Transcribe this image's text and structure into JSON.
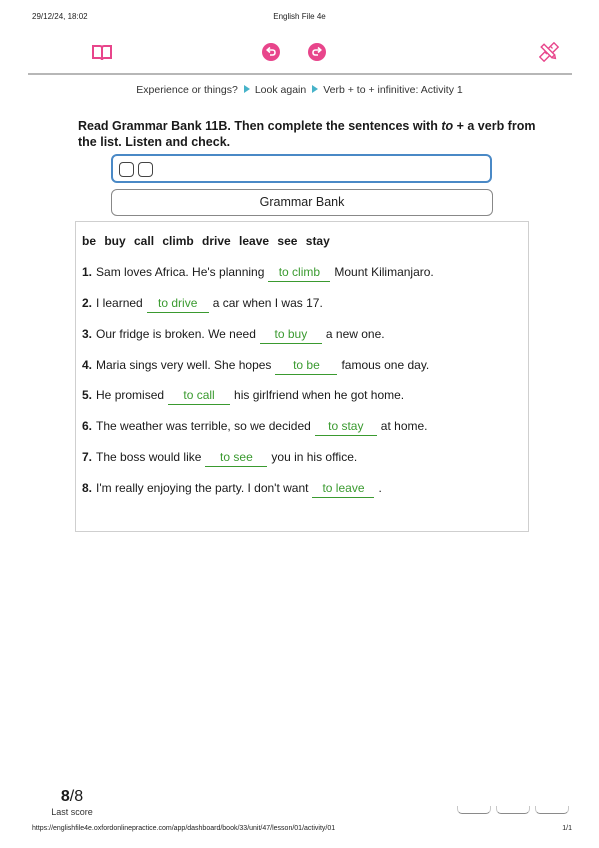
{
  "print_header": {
    "date": "29/12/24, 18:02",
    "title": "English File 4e"
  },
  "toolbar": {
    "book_icon": "book-icon",
    "undo_icon": "undo-icon",
    "redo_icon": "redo-icon",
    "tools_icon": "pencil-ruler-icon",
    "accent_color": "#e8458b"
  },
  "breadcrumb": {
    "items": [
      "Experience or things?",
      "Look again",
      "Verb + to + infinitive: Activity 1"
    ]
  },
  "instruction": {
    "part1": "Read Grammar Bank 11B. Then complete the sentences with ",
    "emph": "to",
    "part2": " + a verb from the list. Listen and check."
  },
  "grammar_bank_button": "Grammar Bank",
  "exercise": {
    "word_list": "be buy call climb drive leave see stay",
    "items": [
      {
        "num": "1.",
        "before": "Sam loves Africa. He's planning",
        "answer": "to climb",
        "after": "Mount Kilimanjaro."
      },
      {
        "num": "2.",
        "before": "I learned",
        "answer": "to drive",
        "after": "a car when I was 17."
      },
      {
        "num": "3.",
        "before": "Our fridge is broken. We need",
        "answer": "to buy",
        "after": "a new one."
      },
      {
        "num": "4.",
        "before": "Maria sings very well. She hopes",
        "answer": "to be",
        "after": "famous one day."
      },
      {
        "num": "5.",
        "before": "He promised",
        "answer": "to call",
        "after": "his girlfriend when he got home."
      },
      {
        "num": "6.",
        "before": "The weather was terrible, so we decided",
        "answer": "to stay",
        "after": "at home."
      },
      {
        "num": "7.",
        "before": "The boss would like",
        "answer": "to see",
        "after": "you in his office."
      },
      {
        "num": "8.",
        "before": "I'm really enjoying the party. I don't want",
        "answer": "to leave",
        "after": "."
      }
    ],
    "answer_color": "#3a9a2f"
  },
  "score": {
    "value": "8",
    "total": "/8",
    "label": "Last score"
  },
  "print_footer": {
    "url": "https://englishfile4e.oxfordonlinepractice.com/app/dashboard/book/33/unit/47/lesson/01/activity/01",
    "page": "1/1"
  }
}
